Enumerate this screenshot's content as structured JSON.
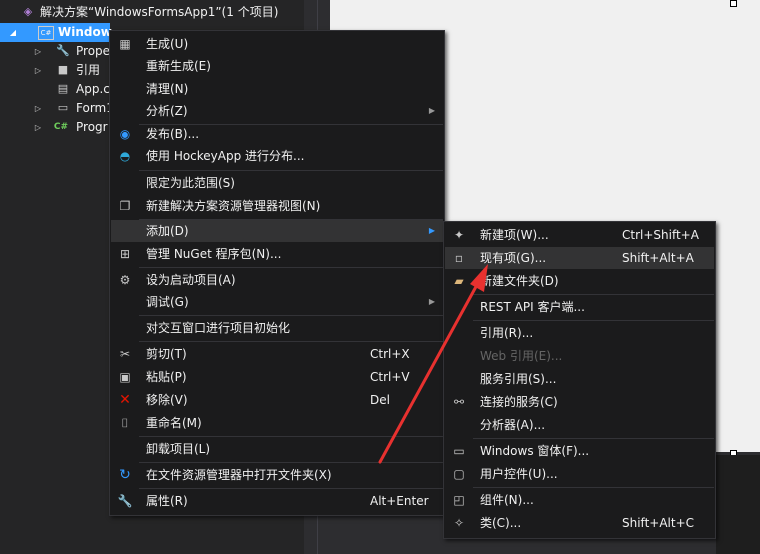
{
  "solution_explorer": {
    "solution_label": "解决方案“WindowsFormsApp1”(1 个项目)",
    "project_label": "Window",
    "items": [
      {
        "label": "Prope",
        "icon": "wrench-icon"
      },
      {
        "label": "引用",
        "icon": "reference-icon"
      },
      {
        "label": "App.c",
        "icon": "config-file-icon"
      },
      {
        "label": "Form1",
        "icon": "form-icon"
      },
      {
        "label": "Progr",
        "icon": "csharp-file-icon"
      }
    ]
  },
  "context_menu": {
    "items": [
      {
        "label": "生成(U)",
        "icon": "build-icon"
      },
      {
        "label": "重新生成(E)"
      },
      {
        "label": "清理(N)"
      },
      {
        "label": "分析(Z)",
        "submenu": true
      },
      {
        "label": "发布(B)...",
        "icon": "globe-icon"
      },
      {
        "label": "使用 HockeyApp 进行分布...",
        "icon": "hockeyapp-icon"
      },
      {
        "label": "限定为此范围(S)"
      },
      {
        "label": "新建解决方案资源管理器视图(N)",
        "icon": "new-view-icon"
      },
      {
        "label": "添加(D)",
        "submenu": true,
        "highlighted": true
      },
      {
        "label": "管理 NuGet 程序包(N)...",
        "icon": "nuget-icon"
      },
      {
        "label": "设为启动项目(A)",
        "icon": "gear-icon"
      },
      {
        "label": "调试(G)",
        "submenu": true
      },
      {
        "label": "对交互窗口进行项目初始化"
      },
      {
        "label": "剪切(T)",
        "shortcut": "Ctrl+X",
        "icon": "scissors-icon"
      },
      {
        "label": "粘贴(P)",
        "shortcut": "Ctrl+V",
        "icon": "paste-icon"
      },
      {
        "label": "移除(V)",
        "shortcut": "Del",
        "icon": "remove-icon"
      },
      {
        "label": "重命名(M)",
        "icon": "rename-icon"
      },
      {
        "label": "卸载项目(L)"
      },
      {
        "label": "在文件资源管理器中打开文件夹(X)",
        "icon": "refresh-folder-icon"
      },
      {
        "label": "属性(R)",
        "shortcut": "Alt+Enter",
        "icon": "wrench-icon"
      }
    ]
  },
  "add_submenu": {
    "items": [
      {
        "label": "新建项(W)...",
        "shortcut": "Ctrl+Shift+A",
        "icon": "new-item-icon"
      },
      {
        "label": "现有项(G)...",
        "shortcut": "Shift+Alt+A",
        "icon": "existing-item-icon",
        "highlighted": true
      },
      {
        "label": "新建文件夹(D)",
        "icon": "new-folder-icon"
      },
      {
        "label": "REST API 客户端..."
      },
      {
        "label": "引用(R)..."
      },
      {
        "label": "Web 引用(E)...",
        "disabled": true
      },
      {
        "label": "服务引用(S)..."
      },
      {
        "label": "连接的服务(C)",
        "icon": "connected-service-icon"
      },
      {
        "label": "分析器(A)..."
      },
      {
        "label": "Windows 窗体(F)...",
        "icon": "windows-form-icon"
      },
      {
        "label": "用户控件(U)...",
        "icon": "user-control-icon"
      },
      {
        "label": "组件(N)...",
        "icon": "component-icon"
      },
      {
        "label": "类(C)...",
        "shortcut": "Shift+Alt+C",
        "icon": "class-icon"
      }
    ]
  },
  "colors": {
    "accent": "#3399ff",
    "menu_bg": "#1b1b1c",
    "highlight": "#333334",
    "annotation_arrow": "#e8312f"
  }
}
